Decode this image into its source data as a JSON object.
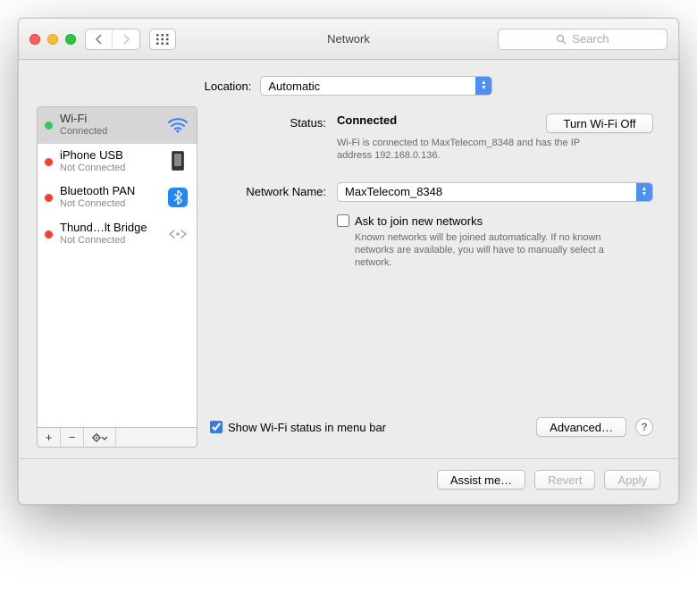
{
  "window": {
    "title": "Network"
  },
  "toolbar": {
    "search_placeholder": "Search"
  },
  "location": {
    "label": "Location:",
    "value": "Automatic"
  },
  "sidebar": {
    "items": [
      {
        "name": "Wi-Fi",
        "sub": "Connected",
        "status": "green",
        "icon": "wifi",
        "selected": true
      },
      {
        "name": "iPhone USB",
        "sub": "Not Connected",
        "status": "red",
        "icon": "phone"
      },
      {
        "name": "Bluetooth PAN",
        "sub": "Not Connected",
        "status": "red",
        "icon": "bluetooth"
      },
      {
        "name": "Thund…lt Bridge",
        "sub": "Not Connected",
        "status": "red",
        "icon": "thunderbolt"
      }
    ],
    "actions": {
      "add": "+",
      "remove": "−",
      "gear": "⚙︎▾"
    }
  },
  "detail": {
    "status_label": "Status:",
    "status_value": "Connected",
    "turn_off": "Turn Wi-Fi Off",
    "status_desc": "Wi-Fi is connected to MaxTelecom_8348 and has the IP address 192.168.0.136.",
    "network_label": "Network Name:",
    "network_value": "MaxTelecom_8348",
    "ask_join": "Ask to join new networks",
    "ask_desc": "Known networks will be joined automatically. If no known networks are available, you will have to manually select a network.",
    "show_status": "Show Wi-Fi status in menu bar",
    "advanced": "Advanced…"
  },
  "footer": {
    "assist": "Assist me…",
    "revert": "Revert",
    "apply": "Apply"
  }
}
